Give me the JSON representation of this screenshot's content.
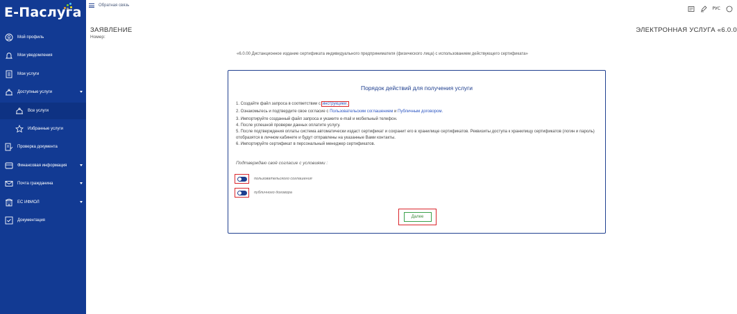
{
  "brand": {
    "logo_text": "Е-Паслуга"
  },
  "sidebar": {
    "items": [
      {
        "label": "Мой профиль",
        "icon": "user-circle-icon"
      },
      {
        "label": "Мои уведомления",
        "icon": "bell-icon"
      },
      {
        "label": "Мои услуги",
        "icon": "document-list-icon"
      },
      {
        "label": "Доступные услуги",
        "icon": "services-icon",
        "expandable": true
      },
      {
        "label": "Все услуги",
        "icon": "services-icon",
        "sub": true,
        "active": true
      },
      {
        "label": "Избранные услуги",
        "icon": "star-icon",
        "sub": true
      },
      {
        "label": "Проверка документа",
        "icon": "document-check-icon"
      },
      {
        "label": "Финансовая информация",
        "icon": "finance-icon",
        "expandable": true
      },
      {
        "label": "Почта гражданина",
        "icon": "mail-icon",
        "expandable": true
      },
      {
        "label": "ЕС ИФИОЛ",
        "icon": "building-icon",
        "expandable": true
      },
      {
        "label": "Документация",
        "icon": "checklist-icon"
      }
    ]
  },
  "topbar": {
    "feedback_label": "Обратная связь",
    "lang_label": "РУС"
  },
  "page": {
    "title": "ЗАЯВЛЕНИЕ",
    "number_label": "Номер:",
    "service_title": "ЭЛЕКТРОННАЯ УСЛУГА «6.0.0",
    "service_desc": "«6.0.00 Дистанционное издание сертификата индивидуального предпринимателя (физического лица) с использованием действующего сертификата»"
  },
  "dialog": {
    "title": "Порядок действий для получения услуги",
    "step1_prefix": "1. Создайте файл запроса в соответствии с ",
    "step1_link": "инструкцией.",
    "step2_prefix": "2. Ознакомьтесь и подтвердите свое согласие с ",
    "step2_link1": "Пользовательским соглашением",
    "step2_mid": " и ",
    "step2_link2": "Публичным договором.",
    "step3": "3. Импортируйте созданный файл запроса и укажите e-mail и мобильный телефон.",
    "step4": "4. После успешной проверки данных оплатите услугу.",
    "step5": "5. После подтверждения оплаты система автоматически издаст сертификат и сохранит его в хранилище сертификатов. Реквизиты доступа к хранилищу сертификатов (логин и пароль) отобразятся в личном кабинете и будут отправлены на указанные Вами контакты.",
    "step6": "6. Импортируйте сертификат в персональный менеджер сертификатов.",
    "confirm_label": "Подтверждаю своё согласие с условиями :",
    "toggle1_label": "пользовательского соглашения",
    "toggle2_label": "публичного договора",
    "toggle1_on": true,
    "toggle2_on": true,
    "next_label": "Далее"
  },
  "colors": {
    "sidebar_bg": "#123a93",
    "accent": "#1f3f8f",
    "highlight": "#d9242a",
    "next_green": "#3aa04a"
  }
}
